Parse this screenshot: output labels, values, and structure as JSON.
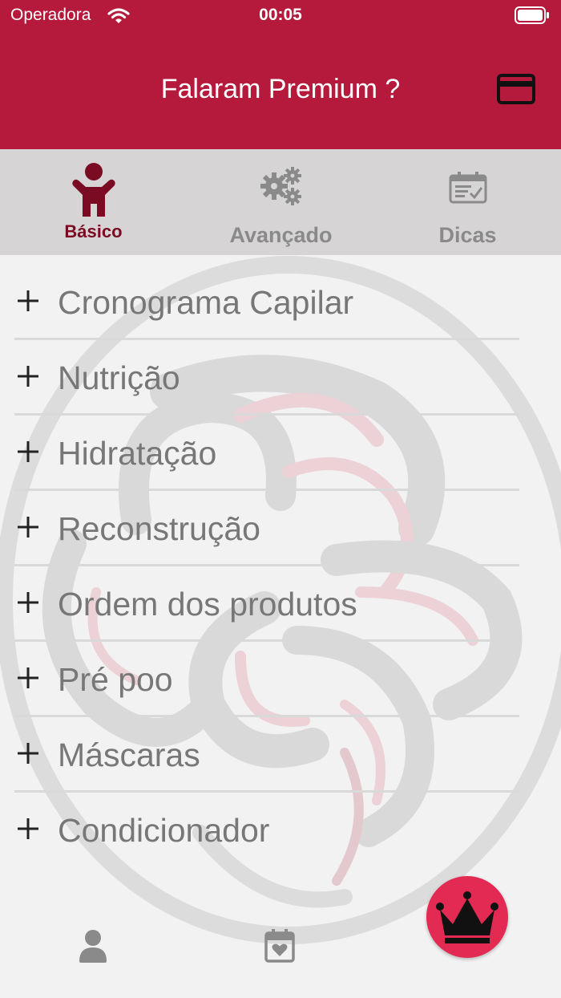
{
  "status_bar": {
    "carrier": "Operadora",
    "time": "00:05"
  },
  "header": {
    "title": "Falaram Premium ?",
    "background": "#b5193b",
    "right_icon": "credit-card-icon"
  },
  "tabs": [
    {
      "label": "Básico",
      "icon": "child-icon",
      "active": true
    },
    {
      "label": "Avançado",
      "icon": "gears-icon",
      "active": false
    },
    {
      "label": "Dicas",
      "icon": "calendar-check-icon",
      "active": false
    }
  ],
  "list": {
    "items": [
      {
        "label": "Cronograma Capilar"
      },
      {
        "label": "Nutrição"
      },
      {
        "label": "Hidratação"
      },
      {
        "label": "Reconstrução"
      },
      {
        "label": "Ordem dos produtos"
      },
      {
        "label": "Pré poo"
      },
      {
        "label": "Máscaras"
      },
      {
        "label": "Condicionador"
      }
    ]
  },
  "bottom": {
    "left_icon": "user-icon",
    "center_icon": "calendar-heart-icon",
    "fab_icon": "crown-icon",
    "fab_color": "#e22a52"
  },
  "colors": {
    "active_tab": "#7a0b22",
    "inactive_tab": "#8a8a8a",
    "tab_bar": "#d6d4d4"
  }
}
